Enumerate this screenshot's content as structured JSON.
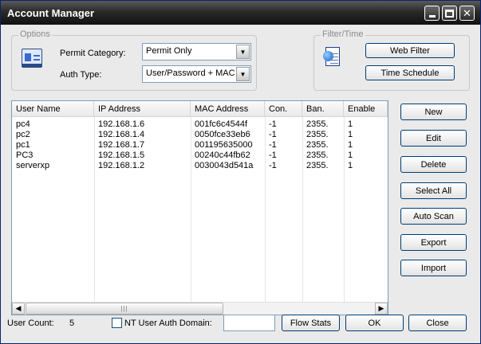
{
  "window": {
    "title": "Account Manager"
  },
  "options": {
    "group_label": "Options",
    "permit_category_label": "Permit Category:",
    "permit_category_value": "Permit Only",
    "auth_type_label": "Auth Type:",
    "auth_type_value": "User/Password + MAC"
  },
  "filter": {
    "group_label": "Filter/Time",
    "web_filter_label": "Web Filter",
    "time_schedule_label": "Time Schedule"
  },
  "table": {
    "columns": [
      "User Name",
      "IP Address",
      "MAC Address",
      "Con.",
      "Ban.",
      "Enable"
    ],
    "rows": [
      [
        "pc4",
        "192.168.1.6",
        "001fc6c4544f",
        "-1",
        "2355.",
        "1"
      ],
      [
        "pc2",
        "192.168.1.4",
        "0050fce33eb6",
        "-1",
        "2355.",
        "1"
      ],
      [
        "pc1",
        "192.168.1.7",
        "001195635000",
        "-1",
        "2355.",
        "1"
      ],
      [
        "PC3",
        "192.168.1.5",
        "00240c44fb62",
        "-1",
        "2355.",
        "1"
      ],
      [
        "serverxp",
        "192.168.1.2",
        "0030043d541a",
        "-1",
        "2355.",
        "1"
      ]
    ]
  },
  "side_buttons": {
    "new": "New",
    "edit": "Edit",
    "delete": "Delete",
    "select_all": "Select All",
    "auto_scan": "Auto Scan",
    "export": "Export",
    "import": "Import"
  },
  "footer": {
    "user_count_label": "User Count:",
    "user_count_value": "5",
    "nt_domain_label": "NT User Auth Domain:",
    "flow_stats_label": "Flow Stats",
    "ok_label": "OK",
    "close_label": "Close"
  }
}
